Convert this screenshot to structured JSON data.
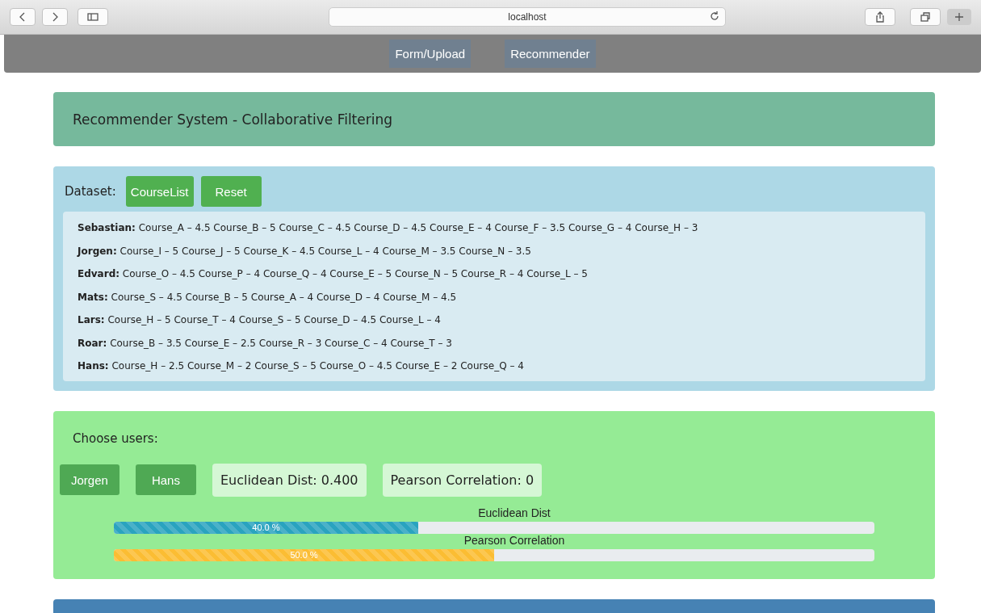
{
  "browser": {
    "address": "localhost"
  },
  "nav": {
    "links": [
      "Form/Upload",
      "Recommender"
    ]
  },
  "header": {
    "title": "Recommender System - Collaborative Filtering"
  },
  "dataset": {
    "label": "Dataset:",
    "buttons": [
      "CourseList",
      "Reset"
    ],
    "rows": [
      {
        "name": "Sebastian:",
        "ratings": "Course_A – 4.5 Course_B – 5 Course_C – 4.5 Course_D – 4.5 Course_E – 4 Course_F – 3.5 Course_G – 4 Course_H – 3"
      },
      {
        "name": "Jorgen:",
        "ratings": "Course_I – 5 Course_J – 5 Course_K – 4.5 Course_L – 4 Course_M – 3.5 Course_N – 3.5"
      },
      {
        "name": "Edvard:",
        "ratings": "Course_O – 4.5 Course_P – 4 Course_Q – 4 Course_E – 5 Course_N – 5 Course_R – 4 Course_L – 5"
      },
      {
        "name": "Mats:",
        "ratings": "Course_S – 4.5 Course_B – 5 Course_A – 4 Course_D – 4 Course_M – 4.5"
      },
      {
        "name": "Lars:",
        "ratings": "Course_H – 5 Course_T – 4 Course_S – 5 Course_D – 4.5 Course_L – 4"
      },
      {
        "name": "Roar:",
        "ratings": "Course_B – 3.5 Course_E – 2.5 Course_R – 3 Course_C – 4 Course_T – 3"
      },
      {
        "name": "Hans:",
        "ratings": "Course_H – 2.5 Course_M – 2 Course_S – 5 Course_O – 4.5 Course_E – 2 Course_Q – 4"
      }
    ]
  },
  "users": {
    "label": "Choose users:",
    "buttons": [
      "Jorgen",
      "Hans"
    ],
    "results": [
      "Euclidean Dist: 0.400",
      "Pearson Correlation: 0"
    ],
    "bars": [
      {
        "title": "Euclidean Dist",
        "level": 0.4,
        "reading": "40.0 %",
        "color": "#2aa3bf"
      },
      {
        "title": "Pearson Correlation",
        "level": 0.5,
        "reading": "50.0 %",
        "color": "#fbbd33"
      }
    ]
  }
}
